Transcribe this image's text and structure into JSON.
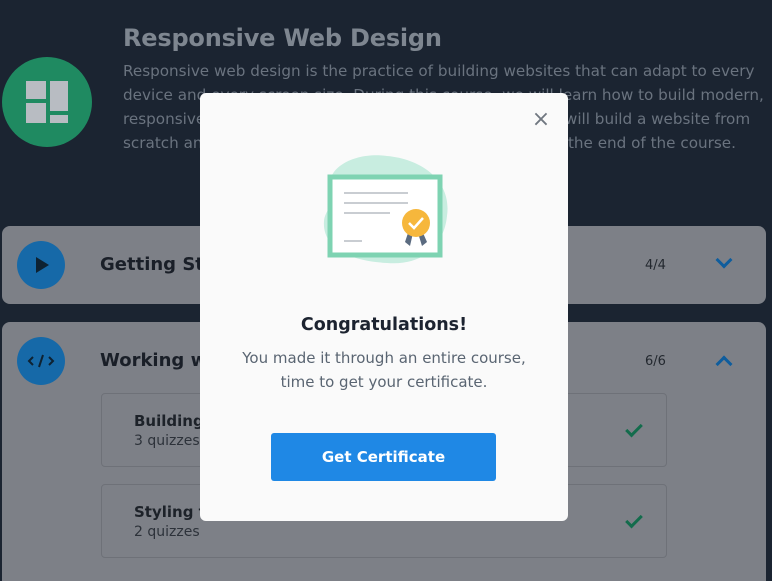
{
  "course": {
    "title": "Responsive Web Design",
    "description": "Responsive web design is the practice of building websites that can adapt to every device and every screen size. During this course, we will learn how to build modern, responsive websites with HTML and CSS. As a project, we will build a website from scratch and then add interactivity to it using JavaScript at the end of the course."
  },
  "sections": [
    {
      "title": "Getting Started",
      "progress": "4/4"
    },
    {
      "title": "Working with HTML",
      "progress": "6/6",
      "lessons": [
        {
          "title": "Building the page",
          "subtitle": "3 quizzes"
        },
        {
          "title": "Styling the page",
          "subtitle": "2 quizzes"
        }
      ]
    }
  ],
  "modal": {
    "close_label": "×",
    "title": "Congratulations!",
    "message": "You made it through an entire course, time to get your certificate.",
    "button_label": "Get Certificate"
  },
  "colors": {
    "accent": "#1f88e5",
    "success": "#2bb27c",
    "certificate_border": "#7ed3b2",
    "ribbon_badge": "#f6b73c"
  },
  "icons": {
    "course": "layout-grid-icon",
    "section1": "play-icon",
    "section2": "code-icon",
    "modal": "certificate-icon"
  }
}
